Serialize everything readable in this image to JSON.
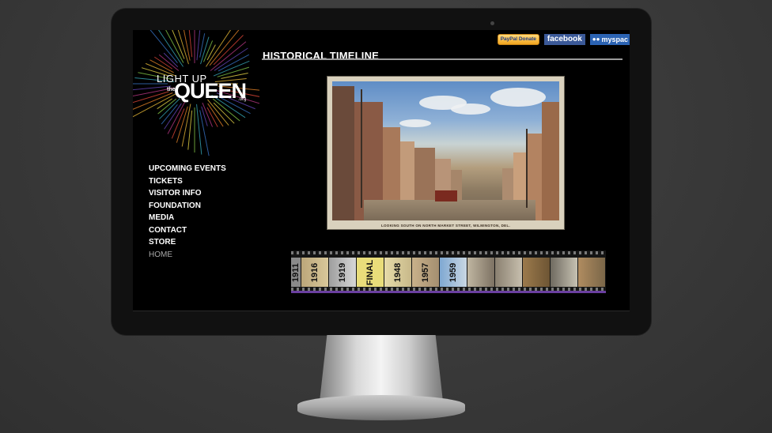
{
  "page": {
    "logo": {
      "line1": "LIGHT UP",
      "the": "the",
      "queen": "QUEEN",
      "org": ".org"
    },
    "nav": [
      "UPCOMING EVENTS",
      "TICKETS",
      "VISITOR INFO",
      "FOUNDATION",
      "MEDIA",
      "CONTACT",
      "STORE",
      "HOME"
    ],
    "heading": "HISTORICAL TIMELINE",
    "badges": {
      "paypal": "PayPal Donate",
      "facebook": "facebook",
      "myspace": "myspac"
    },
    "postcard_caption": "LOOKING SOUTH ON NORTH MARKET STREET, WILMINGTON, DEL.",
    "timeline_years": [
      "1911",
      "1916",
      "1919",
      "FINAL",
      "1948",
      "1957",
      "1959",
      "",
      "",
      "",
      "",
      ""
    ]
  },
  "colors": {
    "accent_purple": "#6a3fa0",
    "screen_bg": "#000000",
    "text": "#ffffff"
  }
}
